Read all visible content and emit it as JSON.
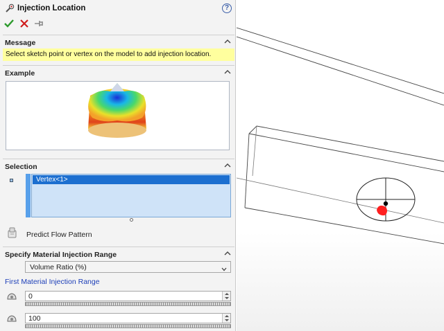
{
  "header": {
    "title": "Injection Location",
    "help_icon": "question-circle-icon",
    "help_label": "?"
  },
  "actions": {
    "ok_icon": "checkmark-icon",
    "cancel_icon": "close-icon",
    "pin_icon": "pushpin-icon"
  },
  "message": {
    "header": "Message",
    "text": "Select sketch point or vertex on the model to add injection location."
  },
  "example": {
    "header": "Example"
  },
  "selection": {
    "header": "Selection",
    "items": [
      "Vertex<1>"
    ]
  },
  "predict": {
    "label": "Predict Flow Pattern"
  },
  "injection_range": {
    "header": "Specify Material Injection Range",
    "mode_value": "Volume Ratio (%)",
    "first_range_label": "First Material Injection Range",
    "start_value": "0",
    "end_value": "100"
  },
  "colors": {
    "accent": "#1c6fd0",
    "message_bg": "#ffff9e",
    "link": "#1d3fb8",
    "ok": "#2c9a2c",
    "cancel": "#d01c1c"
  }
}
